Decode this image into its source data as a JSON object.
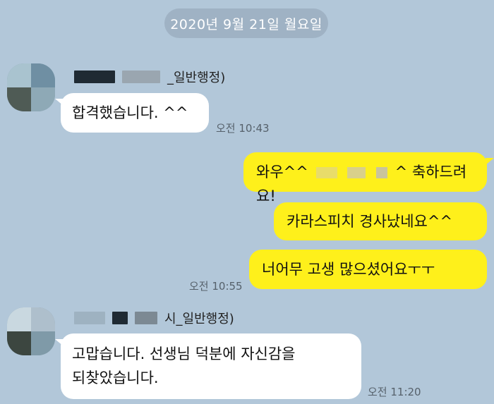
{
  "date_divider": "2020년 9월 21일 월요일",
  "messages": [
    {
      "sender_suffix": "_일반행정)",
      "lines": [
        "합격했습니다. ^^"
      ],
      "time": "오전 10:43"
    },
    {
      "outgoing": [
        {
          "prefix": "와우^^",
          "suffix": "^ 축하드려요!"
        },
        {
          "text": "카라스피치 경사났네요^^"
        },
        {
          "text": "너어무 고생 많으셨어요ㅜㅜ"
        }
      ],
      "time": "오전 10:55"
    },
    {
      "sender_suffix": "시_일반행정)",
      "lines": [
        "고맙습니다. 선생님 덕분에 자신감을",
        "되찾았습니다."
      ],
      "time": "오전 11:20"
    }
  ],
  "colors": {
    "background": "#b2c7d9",
    "outgoing_bubble": "#fef01b",
    "incoming_bubble": "#ffffff",
    "date_pill": "#9fb2c4"
  }
}
